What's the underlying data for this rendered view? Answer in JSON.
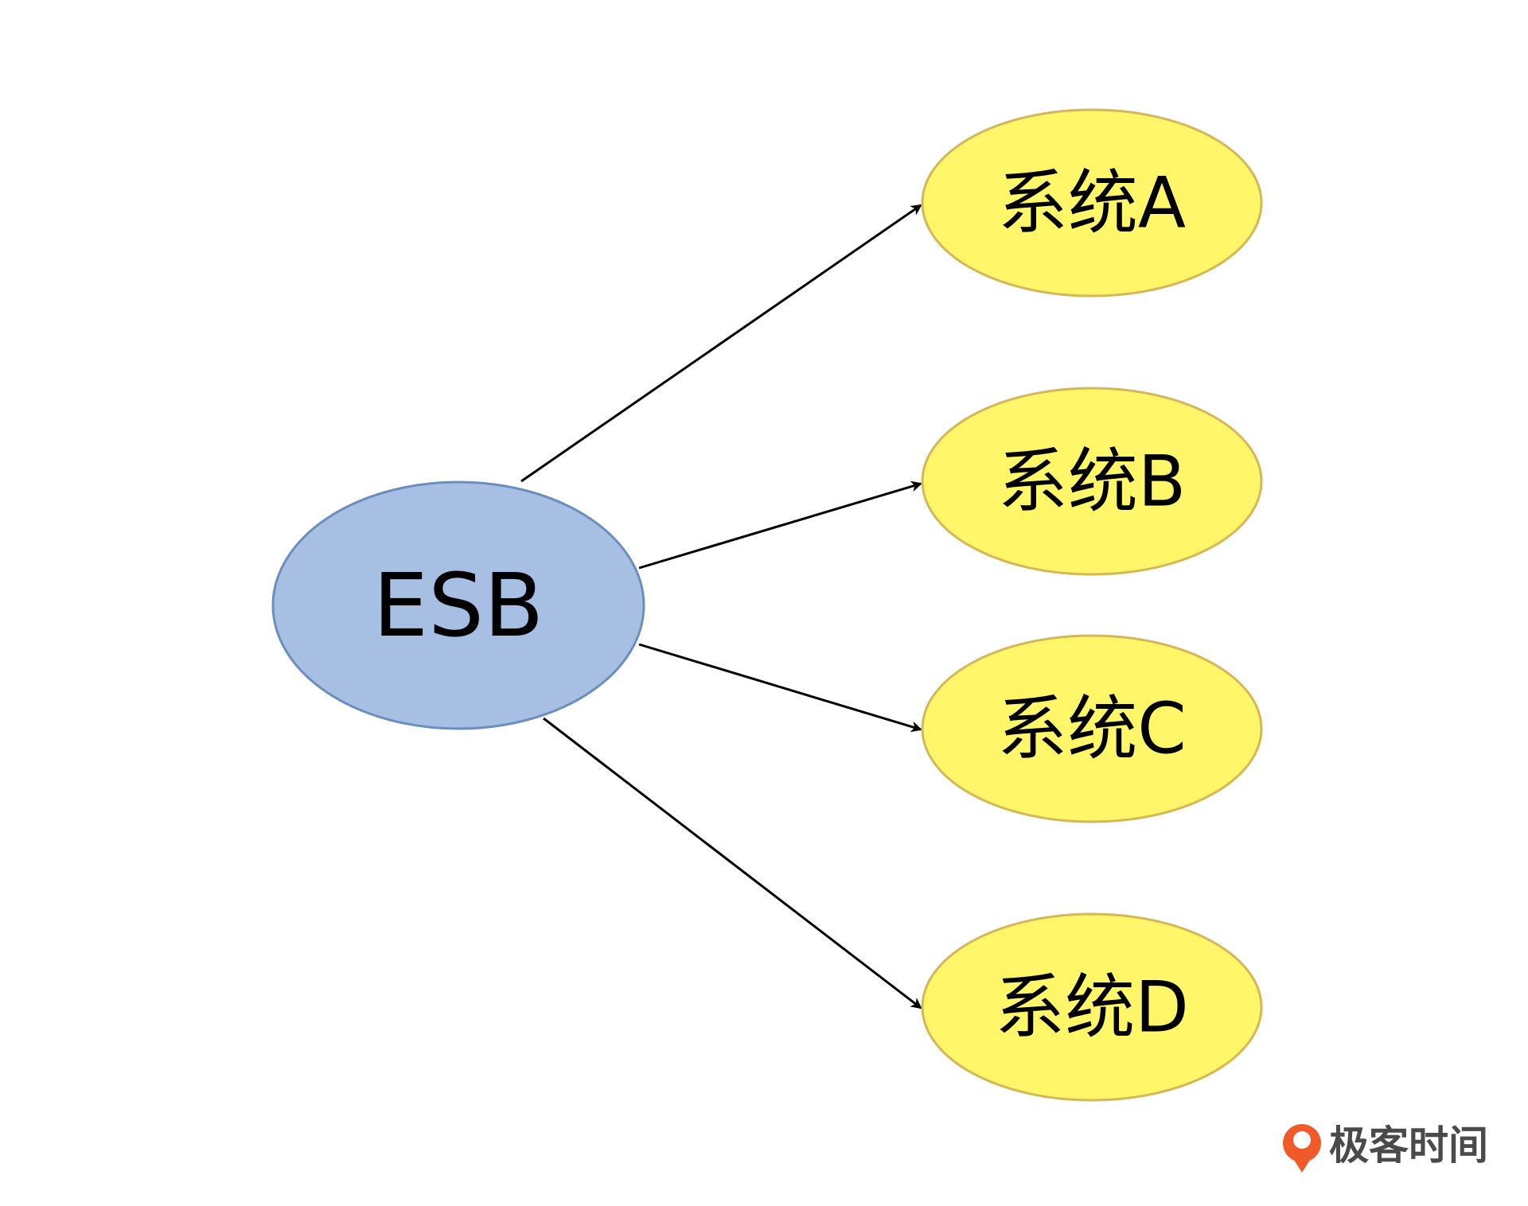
{
  "diagram": {
    "hub": {
      "label": "ESB",
      "fill": "#a7bfe3",
      "stroke": "#6c8ebf"
    },
    "targets": [
      {
        "label": "系统A"
      },
      {
        "label": "系统B"
      },
      {
        "label": "系统C"
      },
      {
        "label": "系统D"
      }
    ],
    "target_fill": "#fff66a",
    "target_stroke": "#d6b656",
    "edge_color": "#000000"
  },
  "watermark": {
    "text": "极客时间",
    "icon": "geektime-logo-icon",
    "icon_color": "#f05a28"
  }
}
